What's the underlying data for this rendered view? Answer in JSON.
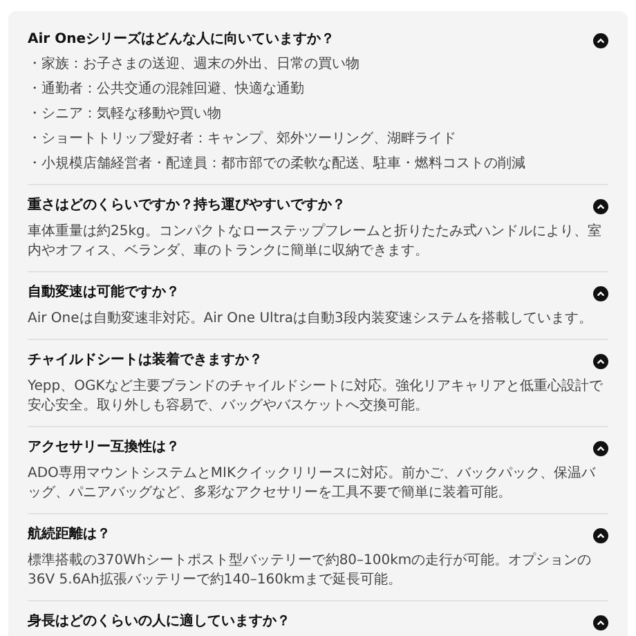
{
  "faq": [
    {
      "question": "Air Oneシリーズはどんな人に向いていますか？",
      "expanded": true,
      "answer": [
        "・家族：お子さまの送迎、週末の外出、日常の買い物",
        "・通勤者：公共交通の混雑回避、快適な通勤",
        "・シニア：気軽な移動や買い物",
        "・ショートトリップ愛好者：キャンプ、郊外ツーリング、湖畔ライド",
        "・小規模店舗経営者・配達員：都市部での柔軟な配送、駐車・燃料コストの削減"
      ]
    },
    {
      "question": "重さはどのくらいですか？持ち運びやすいですか？",
      "expanded": true,
      "answer": [
        "車体重量は約25kg。コンパクトなローステップフレームと折りたたみ式ハンドルにより、室内やオフィス、ベランダ、車のトランクに簡単に収納できます。"
      ]
    },
    {
      "question": "自動変速は可能ですか？",
      "expanded": true,
      "answer": [
        "Air Oneは自動変速非対応。Air One Ultraは自動3段内装変速システムを搭載しています。"
      ]
    },
    {
      "question": "チャイルドシートは装着できますか？",
      "expanded": true,
      "answer": [
        "Yepp、OGKなど主要ブランドのチャイルドシートに対応。強化リアキャリアと低重心設計で安心安全。取り外しも容易で、バッグやバスケットへ交換可能。"
      ]
    },
    {
      "question": "アクセサリー互換性は？",
      "expanded": true,
      "answer": [
        "ADO専用マウントシステムとMIKクイックリリースに対応。前かご、バックパック、保温バッグ、パニアバッグなど、多彩なアクセサリーを工具不要で簡単に装着可能。"
      ]
    },
    {
      "question": "航続距離は？",
      "expanded": true,
      "answer": [
        "標準搭載の370Whシートポスト型バッテリーで約80–100kmの走行が可能。オプションの36V 5.6Ah拡張バッテリーで約140–160kmまで延長可能。"
      ]
    },
    {
      "question": "身長はどのくらいの人に適していますか？",
      "expanded": true
    }
  ]
}
